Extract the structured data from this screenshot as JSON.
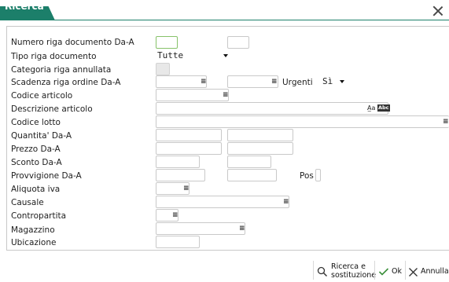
{
  "window": {
    "title": "Ricerca"
  },
  "form": {
    "numero_riga_label": "Numero riga documento Da-A",
    "tipo_riga_label": "Tipo riga documento",
    "tipo_riga_value": "Tutte",
    "categoria_label": "Categoria riga annullata",
    "scadenza_label": "Scadenza riga ordine Da-A",
    "urgenti_label": "Urgenti",
    "urgenti_value": "Sì",
    "codice_articolo_label": "Codice articolo",
    "descrizione_label": "Descrizione articolo",
    "descrizione_icon_text": "Abc",
    "codice_lotto_label": "Codice lotto",
    "quantita_label": "Quantita' Da-A",
    "prezzo_label": "Prezzo Da-A",
    "sconto_label": "Sconto Da-A",
    "provvigione_label": "Provvigione Da-A",
    "pos_label": "Pos",
    "aliquota_label": "Aliquota iva",
    "causale_label": "Causale",
    "contropartita_label": "Contropartita",
    "magazzino_label": "Magazzino",
    "ubicazione_label": "Ubicazione"
  },
  "footer": {
    "ricerca_sostituzione_line1": "Ricerca e",
    "ricerca_sostituzione_line2": "sostituzione",
    "ok_label": "Ok",
    "annulla_label": "Annulla"
  },
  "colors": {
    "accent": "#1c7f6a",
    "active_field_border": "#87c26a"
  },
  "icons": [
    "close-icon",
    "list-icon",
    "translate-icon",
    "text-format-icon",
    "search-icon",
    "check-icon",
    "cancel-icon"
  ]
}
